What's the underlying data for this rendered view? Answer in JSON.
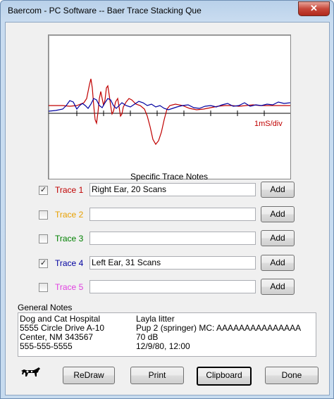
{
  "window": {
    "title": "Baercom - PC Software -- Baer Trace Stacking Que",
    "close_label": "✕"
  },
  "plot": {
    "scale_label": "1mS/div"
  },
  "notes_heading": "Specific Trace Notes",
  "traces": [
    {
      "checked": true,
      "label": "Trace 1",
      "color": "#c00000",
      "note": "Right Ear,  20 Scans",
      "add_label": "Add"
    },
    {
      "checked": false,
      "label": "Trace 2",
      "color": "#e8a000",
      "note": "",
      "add_label": "Add"
    },
    {
      "checked": false,
      "label": "Trace 3",
      "color": "#008000",
      "note": "",
      "add_label": "Add"
    },
    {
      "checked": true,
      "label": "Trace 4",
      "color": "#0000a0",
      "note": "Left Ear,  31 Scans",
      "add_label": "Add"
    },
    {
      "checked": false,
      "label": "Trace 5",
      "color": "#e040e0",
      "note": "",
      "add_label": "Add"
    }
  ],
  "general_notes": {
    "label": "General Notes",
    "left": [
      "Dog and Cat Hospital",
      "5555 Circle Drive A-10",
      "Center, NM  343567",
      "555-555-5555"
    ],
    "right": [
      "Layla litter",
      "Pup 2 (springer)  MC: AAAAAAAAAAAAAAA",
      "70 dB",
      "12/9/80, 12:00"
    ]
  },
  "buttons": {
    "redraw": "ReDraw",
    "print": "Print",
    "clipboard": "Clipboard",
    "done": "Done"
  },
  "icons": {
    "logo": "dog-icon",
    "checkmark": "✓"
  }
}
